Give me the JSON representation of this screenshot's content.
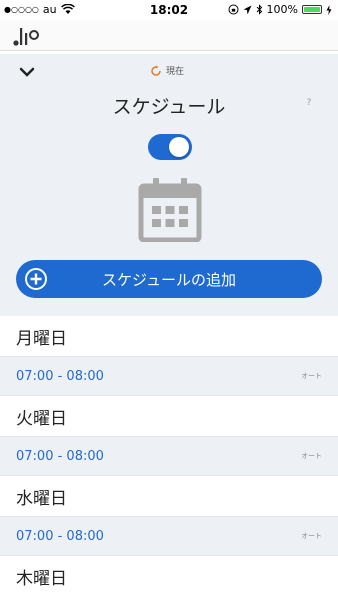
{
  "status_bar": {
    "signal_dots": "●○○○○",
    "carrier": "au",
    "time": "18:02",
    "battery_percent": "100%",
    "battery_color": "#4cd964"
  },
  "header": {
    "now_label": "現在",
    "title": "スケジュール",
    "help_label": "?",
    "schedule_enabled": true
  },
  "add_button": {
    "label": "スケジュールの追加"
  },
  "schedule": [
    {
      "day": "月曜日",
      "time": "07:00 - 08:00",
      "mode": "オート"
    },
    {
      "day": "火曜日",
      "time": "07:00 - 08:00",
      "mode": "オート"
    },
    {
      "day": "水曜日",
      "time": "07:00 - 08:00",
      "mode": "オート"
    },
    {
      "day": "木曜日"
    }
  ],
  "colors": {
    "accent": "#1f6ad1",
    "panel_background": "#edf1f5",
    "icon_gray": "#a9a9a9"
  },
  "icons": [
    "chevron-down-icon",
    "refresh-icon",
    "help-icon",
    "calendar-icon",
    "plus-circle-icon",
    "app-logo-icon",
    "wifi-icon",
    "location-icon",
    "bluetooth-icon",
    "battery-icon",
    "charging-icon"
  ]
}
